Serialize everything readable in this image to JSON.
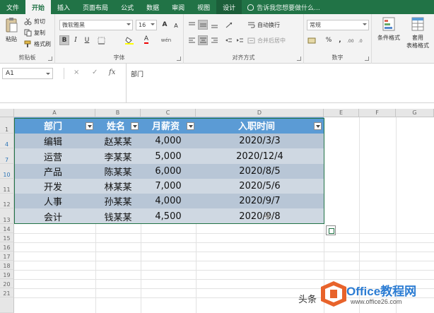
{
  "ribbon_tabs": [
    {
      "label": "文件"
    },
    {
      "label": "开始"
    },
    {
      "label": "插入"
    },
    {
      "label": "页面布局"
    },
    {
      "label": "公式"
    },
    {
      "label": "数据"
    },
    {
      "label": "审阅"
    },
    {
      "label": "视图"
    },
    {
      "label": "设计"
    }
  ],
  "tell_me": "告诉我您想要做什么...",
  "clipboard": {
    "paste": "粘贴",
    "cut": "剪切",
    "copy": "复制",
    "format_painter": "格式刷",
    "group": "剪贴板"
  },
  "font": {
    "name": "微软雅黑",
    "size": "16",
    "grow": "A",
    "shrink": "A",
    "bold": "B",
    "italic": "I",
    "underline": "U",
    "color_letter": "A",
    "wen": "wén",
    "group": "字体"
  },
  "alignment": {
    "wrap": "自动换行",
    "merge": "合并后居中",
    "group": "对齐方式"
  },
  "number": {
    "format": "常规",
    "percent": "%",
    "comma": ",",
    "group": "数字"
  },
  "styles": {
    "conditional": "条件格式",
    "table_format_line1": "套用",
    "table_format_line2": "表格格式"
  },
  "formula_bar": {
    "name_box": "A1",
    "cancel": "×",
    "enter": "✓",
    "fx": "fx",
    "content": "部门"
  },
  "columns": [
    "A",
    "B",
    "C",
    "D",
    "E",
    "F",
    "G"
  ],
  "row_headers": [
    "1",
    "4",
    "7",
    "10",
    "11",
    "12",
    "13",
    "14",
    "15",
    "16",
    "17",
    "18",
    "19",
    "20",
    "21"
  ],
  "table": {
    "headers": [
      "部门",
      "姓名",
      "月薪资",
      "入职时间"
    ],
    "rows": [
      [
        "编辑",
        "赵某某",
        "4,000",
        "2020/3/3"
      ],
      [
        "运营",
        "李某某",
        "5,000",
        "2020/12/4"
      ],
      [
        "产品",
        "陈某某",
        "6,000",
        "2020/8/5"
      ],
      [
        "开发",
        "林某某",
        "7,000",
        "2020/5/6"
      ],
      [
        "人事",
        "孙某某",
        "4,000",
        "2020/9/7"
      ],
      [
        "会计",
        "钱某某",
        "4,500",
        "2020/9/8"
      ]
    ]
  },
  "watermark": {
    "prefix": "头条",
    "brand": "Office教程网",
    "url": "www.office26.com"
  },
  "colors": {
    "ribbon_green": "#217346",
    "table_header": "#5b9bd5",
    "band_dark": "#b8c6d6",
    "band_light": "#cfd8e2",
    "brand_blue": "#2b7cd3",
    "logo_orange": "#e8632b"
  }
}
